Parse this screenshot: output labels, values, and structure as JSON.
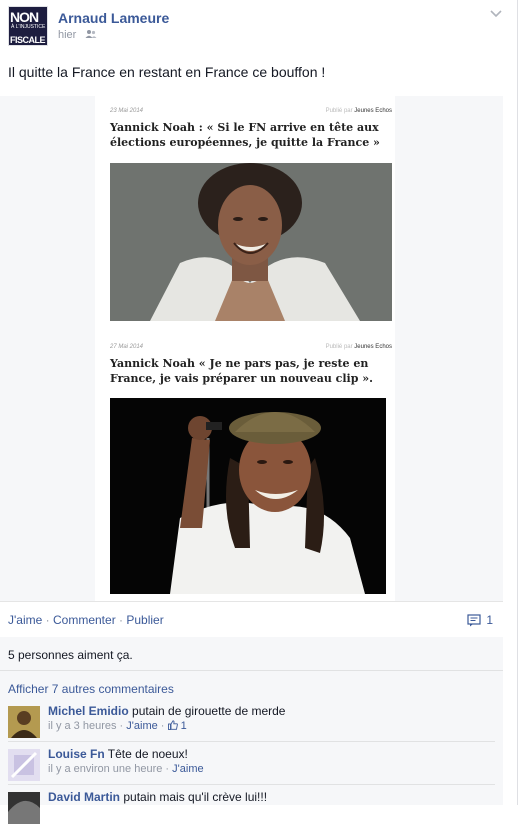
{
  "post": {
    "author": "Arnaud Lameure",
    "time": "hier",
    "privacy_icon": "friends-icon",
    "text": "Il quitte la France en restant en France ce bouffon !",
    "avatar": {
      "line1": "NON",
      "line2": "À L'INJUSTICE",
      "line3": "FISCALE"
    }
  },
  "image": {
    "article1": {
      "date": "23 Mai 2014",
      "published_prefix": "Publié par",
      "source": "Jeunes Echos",
      "headline": "Yannick Noah : « Si le FN arrive en tête aux élections européennes, je quitte la France »"
    },
    "article2": {
      "date": "27 Mai 2014",
      "published_prefix": "Publié par",
      "source": "Jeunes Echos",
      "headline": "Yannick Noah « Je ne pars pas, je reste en France, je vais préparer un nouveau clip »."
    }
  },
  "actions": {
    "like": "J'aime",
    "comment": "Commenter",
    "share": "Publier",
    "separator": "·",
    "comment_count": "1"
  },
  "ufi": {
    "likes_text": "5 personnes aiment ça.",
    "more_comments": "Afficher 7 autres commentaires",
    "comments": [
      {
        "name": "Michel Emidio",
        "text": "putain de girouette de merde",
        "time": "il y a 3 heures",
        "like": "J'aime",
        "like_count": "1",
        "avatar_color": "#a08a3c"
      },
      {
        "name": "Louise Fn",
        "text": "Tête de noeux!",
        "time": "il y a environ une heure",
        "like": "J'aime",
        "avatar_color": "#d8d4ea"
      },
      {
        "name": "David Martin",
        "text": "putain mais qu'il crève lui!!!",
        "avatar_color": "#333333"
      }
    ]
  }
}
